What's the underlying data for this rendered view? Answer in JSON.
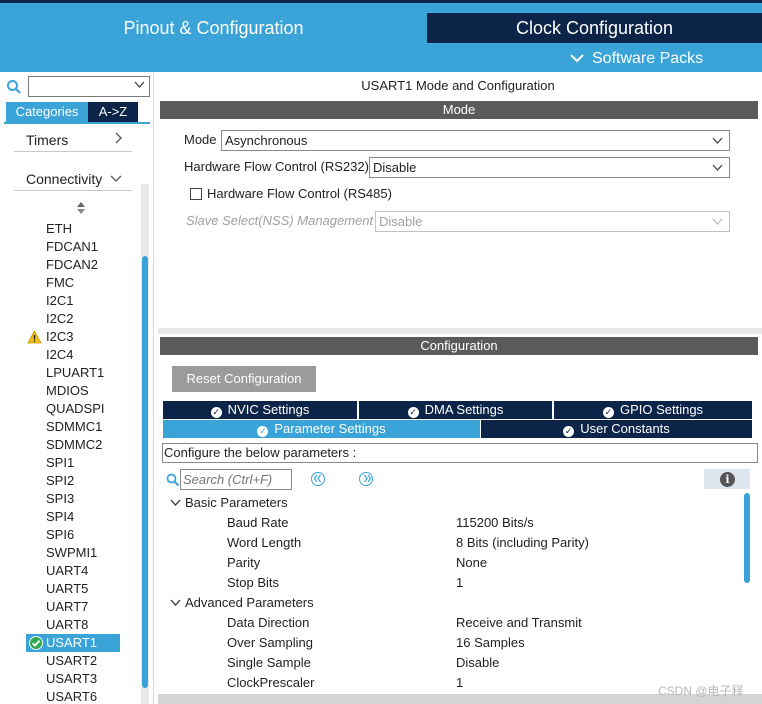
{
  "header": {
    "tab_pinout": "Pinout & Configuration",
    "tab_clock": "Clock Configuration",
    "software_packs": "Software Packs",
    "colors": {
      "accent": "#3aa3d8",
      "dark": "#0b2447"
    }
  },
  "left": {
    "search_value": "",
    "tabs": {
      "categories": "Categories",
      "az": "A->Z"
    },
    "groups": {
      "timers": "Timers",
      "connectivity": "Connectivity"
    },
    "peripherals": [
      "ETH",
      "FDCAN1",
      "FDCAN2",
      "FMC",
      "I2C1",
      "I2C2",
      "I2C3",
      "I2C4",
      "LPUART1",
      "MDIOS",
      "QUADSPI",
      "SDMMC1",
      "SDMMC2",
      "SPI1",
      "SPI2",
      "SPI3",
      "SPI4",
      "SPI6",
      "SWPMI1",
      "UART4",
      "UART5",
      "UART7",
      "UART8",
      "USART1",
      "USART2",
      "USART3",
      "USART6"
    ],
    "warning_item": "I2C3",
    "selected_item": "USART1"
  },
  "right": {
    "title": "USART1 Mode and Configuration",
    "mode_bar": "Mode",
    "mode": {
      "mode_label": "Mode",
      "mode_value": "Asynchronous",
      "hfc232_label": "Hardware Flow Control (RS232)",
      "hfc232_value": "Disable",
      "hfc485_label": "Hardware Flow Control (RS485)",
      "nss_label": "Slave Select(NSS) Management",
      "nss_value": "Disable"
    },
    "config_bar": "Configuration",
    "reset_button": "Reset Configuration",
    "tabs": {
      "nvic": "NVIC Settings",
      "dma": "DMA Settings",
      "gpio": "GPIO Settings",
      "parameter": "Parameter Settings",
      "user_constants": "User Constants"
    },
    "param_header": "Configure the below parameters :",
    "search_placeholder": "Search (Ctrl+F)",
    "basic": {
      "label": "Basic Parameters",
      "rows": [
        {
          "name": "Baud Rate",
          "value": "115200 Bits/s"
        },
        {
          "name": "Word Length",
          "value": "8 Bits (including Parity)"
        },
        {
          "name": "Parity",
          "value": "None"
        },
        {
          "name": "Stop Bits",
          "value": "1"
        }
      ]
    },
    "advanced": {
      "label": "Advanced Parameters",
      "rows": [
        {
          "name": "Data Direction",
          "value": "Receive and Transmit"
        },
        {
          "name": "Over Sampling",
          "value": "16 Samples"
        },
        {
          "name": "Single Sample",
          "value": "Disable"
        },
        {
          "name": "ClockPrescaler",
          "value": "1"
        }
      ]
    }
  },
  "watermark": "CSDN @电子释"
}
